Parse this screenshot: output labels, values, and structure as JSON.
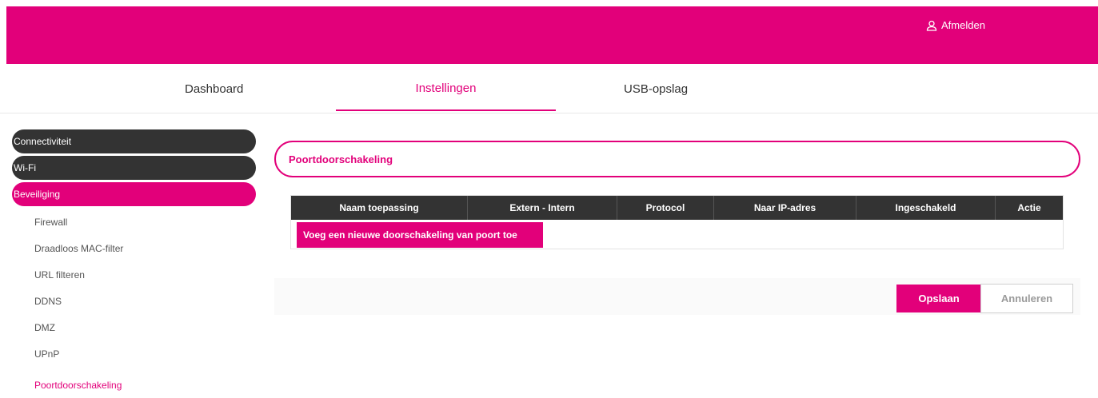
{
  "header": {
    "logout_label": "Afmelden",
    "logout_icon": "user-icon",
    "brand_color": "#e2007a"
  },
  "tabs": [
    {
      "label": "Dashboard"
    },
    {
      "label": "Instellingen",
      "active": true
    },
    {
      "label": "USB-opslag"
    }
  ],
  "sidebar": {
    "groups": [
      {
        "label": "Connectiviteit"
      },
      {
        "label": "Wi-Fi"
      },
      {
        "label": "Beveiliging",
        "active": true
      }
    ],
    "items": [
      {
        "label": "Firewall"
      },
      {
        "label": "Draadloos MAC-filter"
      },
      {
        "label": "URL filteren"
      },
      {
        "label": "DDNS"
      },
      {
        "label": "DMZ"
      },
      {
        "label": "UPnP"
      },
      {
        "label": "Poortdoorschakeling",
        "active": true
      }
    ]
  },
  "main": {
    "title": "Poortdoorschakeling",
    "table": {
      "columns": [
        "Naam toepassing",
        "Extern - Intern",
        "Protocol",
        "Naar IP-adres",
        "Ingeschakeld",
        "Actie"
      ]
    },
    "add_button_label": "Voeg een nieuwe doorschakeling van poort toe",
    "save_label": "Opslaan",
    "cancel_label": "Annuleren"
  }
}
